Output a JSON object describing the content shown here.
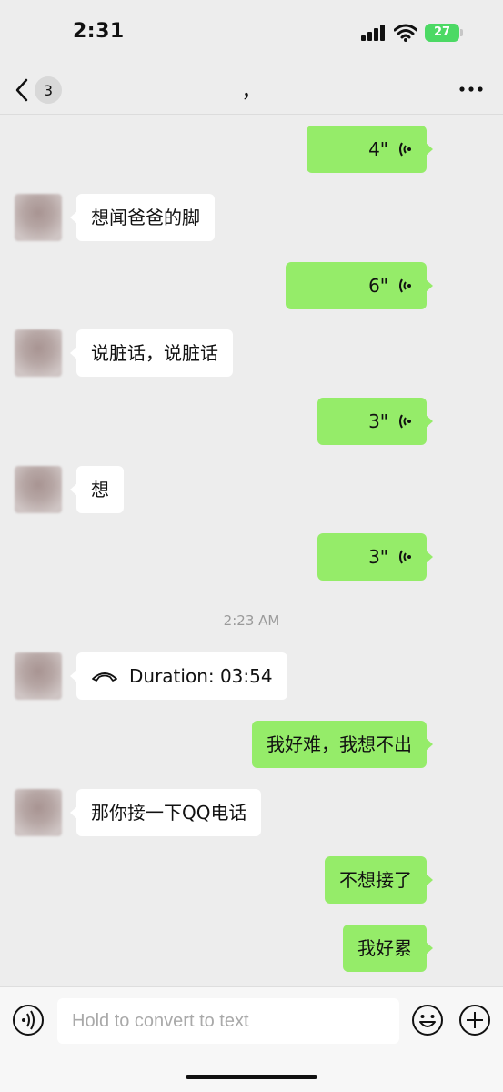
{
  "status": {
    "time": "2:31",
    "battery": "27"
  },
  "nav": {
    "back_count": "3",
    "title": "，"
  },
  "messages": [
    {
      "side": "right",
      "type": "voice",
      "duration": "4\""
    },
    {
      "side": "left",
      "type": "text",
      "text": "想闻爸爸的脚"
    },
    {
      "side": "right",
      "type": "voice",
      "duration": "6\""
    },
    {
      "side": "left",
      "type": "text",
      "text": "说脏话，说脏话"
    },
    {
      "side": "right",
      "type": "voice",
      "duration": "3\""
    },
    {
      "side": "left",
      "type": "text",
      "text": "想"
    },
    {
      "side": "right",
      "type": "voice",
      "duration": "3\""
    },
    {
      "type": "timestamp",
      "text": "2:23 AM"
    },
    {
      "side": "left",
      "type": "call",
      "text": "Duration: 03:54"
    },
    {
      "side": "right",
      "type": "text",
      "text": "我好难，我想不出"
    },
    {
      "side": "left",
      "type": "text",
      "text": "那你接一下QQ电话"
    },
    {
      "side": "right",
      "type": "text",
      "text": "不想接了"
    },
    {
      "side": "right",
      "type": "text",
      "text": "我好累"
    }
  ],
  "input": {
    "placeholder": "Hold to convert to text"
  },
  "colors": {
    "sent_bubble": "#95ec69",
    "received_bubble": "#ffffff",
    "background": "#ededed"
  },
  "icons": [
    "back-chevron-icon",
    "more-icon",
    "voice-wave-icon",
    "phone-hangup-icon",
    "voice-input-icon",
    "emoji-icon",
    "plus-icon",
    "signal-icon",
    "wifi-icon",
    "battery-icon"
  ]
}
